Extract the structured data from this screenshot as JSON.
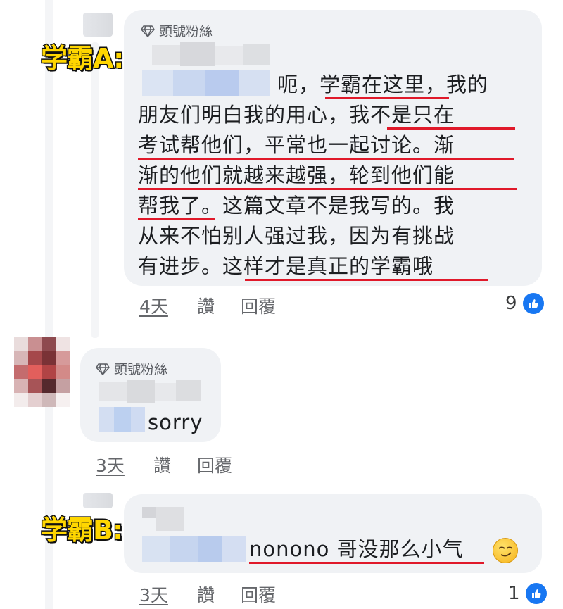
{
  "comments": [
    {
      "id": "A",
      "badge": "頭號粉絲",
      "annotation": "学霸A:",
      "lines": [
        "呃，学霸在这里，我的",
        "朋友们明白我的用心，我不是只在",
        "考试帮他们，平常也一起讨论。渐",
        "渐的他们就越来越强，轮到他们能",
        "帮我了。这篇文章不是我写的。我",
        "从来不怕别人强过我，因为有挑战",
        "有进步。这样才是真正的学霸哦"
      ],
      "time": "4天",
      "like_label": "讚",
      "reply_label": "回覆",
      "like_count": "9"
    },
    {
      "id": "reply",
      "badge": "頭號粉絲",
      "lines": [
        "sorry"
      ],
      "time": "3天",
      "like_label": "讚",
      "reply_label": "回覆"
    },
    {
      "id": "B",
      "annotation": "学霸B:",
      "lines": [
        "nonono 哥没那么小气"
      ],
      "emoji": "smirking-face",
      "time": "3天",
      "like_label": "讚",
      "reply_label": "回覆",
      "like_count": "1"
    }
  ],
  "colors": {
    "bubble": "#f0f2f5",
    "underline": "#e0192a",
    "like_blue": "#1877f2",
    "label_yellow": "#ffd600"
  }
}
